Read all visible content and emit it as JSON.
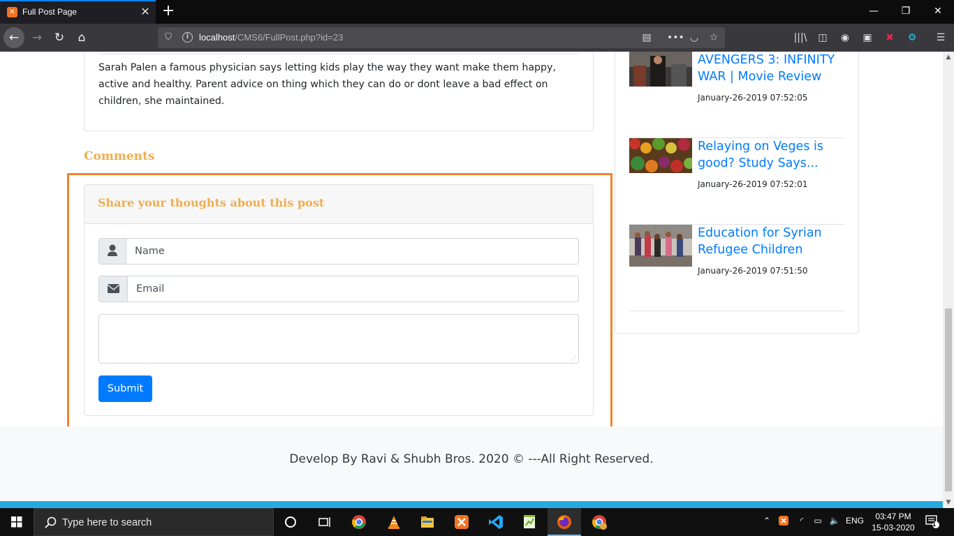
{
  "browser": {
    "tab_title": "Full Post Page",
    "tab_favicon": "xampp-icon",
    "url_host": "localhost",
    "url_path": "/CMS6/FullPost.php?id=23"
  },
  "post": {
    "body": "Sarah Palen a famous physician says letting kids play the way they want make them happy, active and healthy. Parent advice on thing which they can do or dont leave a bad effect on children, she maintained."
  },
  "comments": {
    "heading": "Comments",
    "card_title": "Share your thoughts about this post",
    "name_placeholder": "Name",
    "email_placeholder": "Email",
    "submit_label": "Submit"
  },
  "sidebar": {
    "items": [
      {
        "title": "AVENGERS 3: INFINITY WAR | Movie Review",
        "date": "January-26-2019 07:52:05"
      },
      {
        "title": "Relaying on Veges is good? Study Says...",
        "date": "January-26-2019 07:52:01"
      },
      {
        "title": "Education for Syrian Refugee Children",
        "date": "January-26-2019 07:51:50"
      }
    ]
  },
  "footer": {
    "text": "Develop By Ravi & Shubh Bros. 2020 © ---All Right Reserved."
  },
  "taskbar": {
    "search_placeholder": "Type here to search",
    "language": "ENG",
    "time": "03:47 PM",
    "date": "15-03-2020",
    "notification_count": "1"
  },
  "colors": {
    "accent_link": "#007bff",
    "heading_orange": "#f0ad4e",
    "highlight_border": "#f5822a",
    "footer_bar": "#27aae1"
  }
}
